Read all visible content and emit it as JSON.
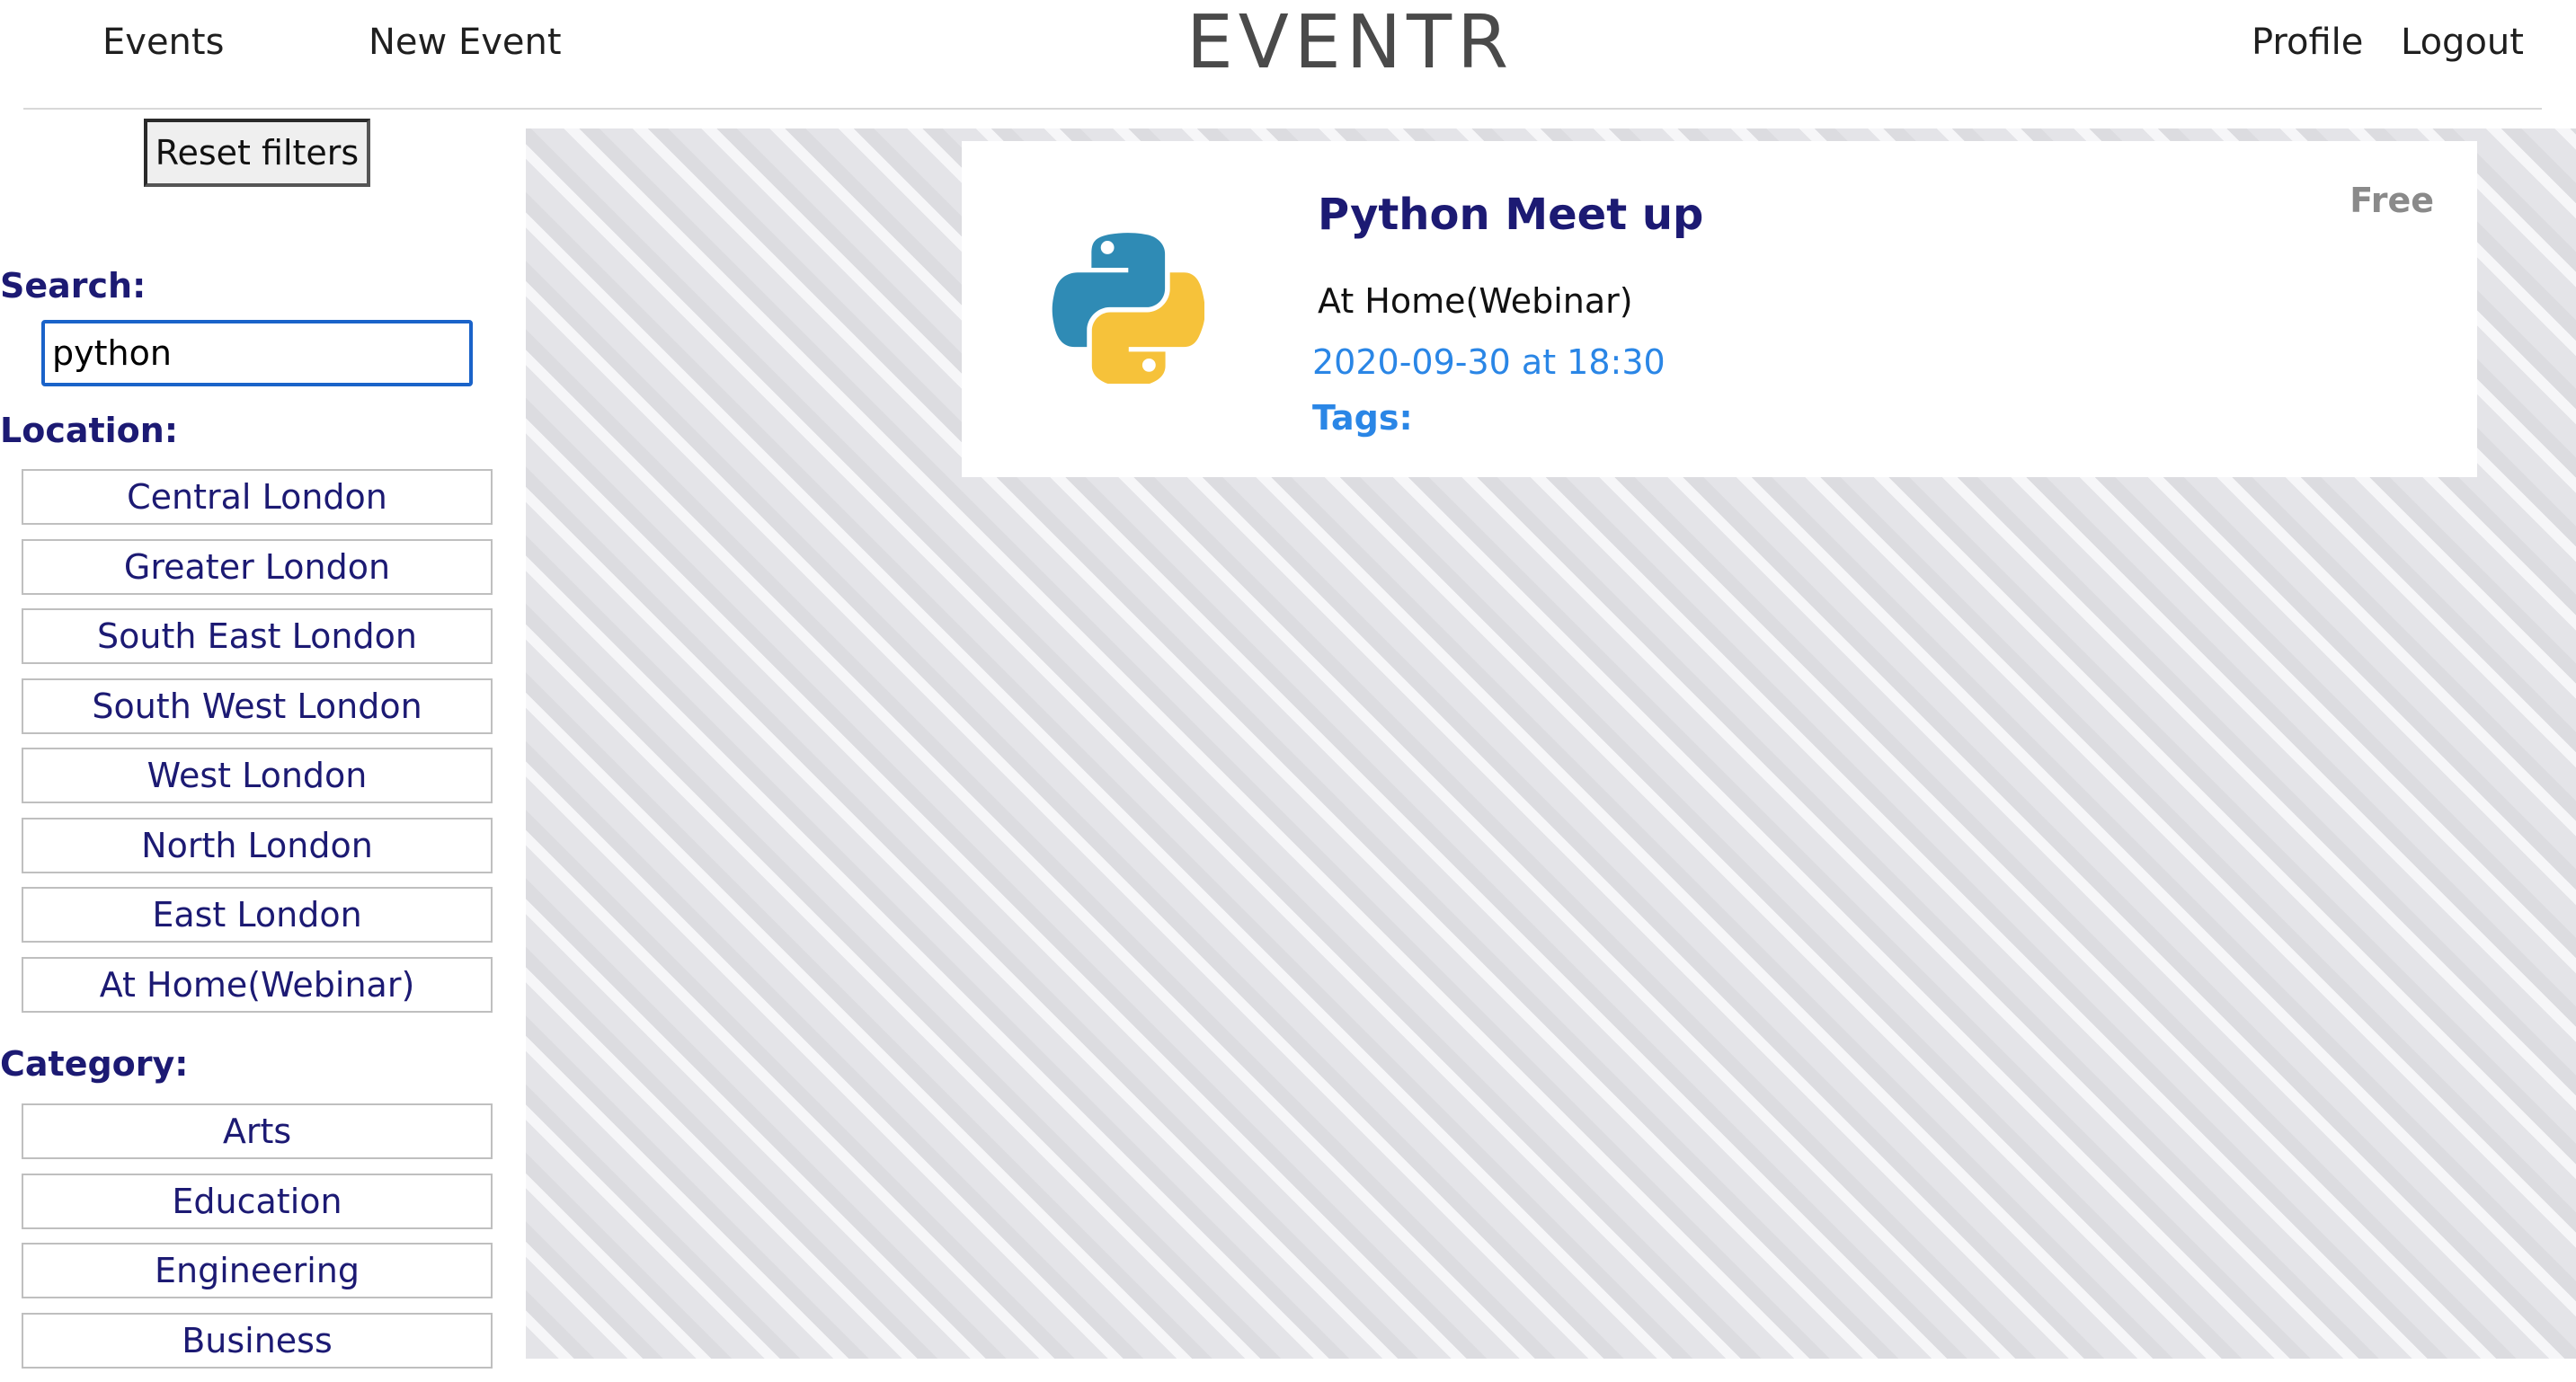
{
  "header": {
    "brand": "EVENTR",
    "nav_left": {
      "events": "Events",
      "new_event": "New Event"
    },
    "nav_right": {
      "profile": "Profile",
      "logout": "Logout"
    }
  },
  "sidebar": {
    "reset_label": "Reset filters",
    "search": {
      "heading": "Search:",
      "value": "python"
    },
    "location": {
      "heading": "Location:",
      "items": [
        "Central London",
        "Greater London",
        "South East London",
        "South West London",
        "West London",
        "North London",
        "East London",
        "At Home(Webinar)"
      ]
    },
    "category": {
      "heading": "Category:",
      "items": [
        "Arts",
        "Education",
        "Engineering",
        "Business"
      ]
    }
  },
  "events": [
    {
      "title": "Python Meet up",
      "location": "At Home(Webinar)",
      "datetime": "2020-09-30 at 18:30",
      "tags_label": "Tags:",
      "price": "Free",
      "logo_icon": "python-logo-icon"
    }
  ],
  "colors": {
    "accent_navy": "#1c1a73",
    "link_blue": "#2a86e6",
    "input_border": "#1a63c9",
    "python_blue": "#2f8bb5",
    "python_yellow": "#f6c23a"
  }
}
